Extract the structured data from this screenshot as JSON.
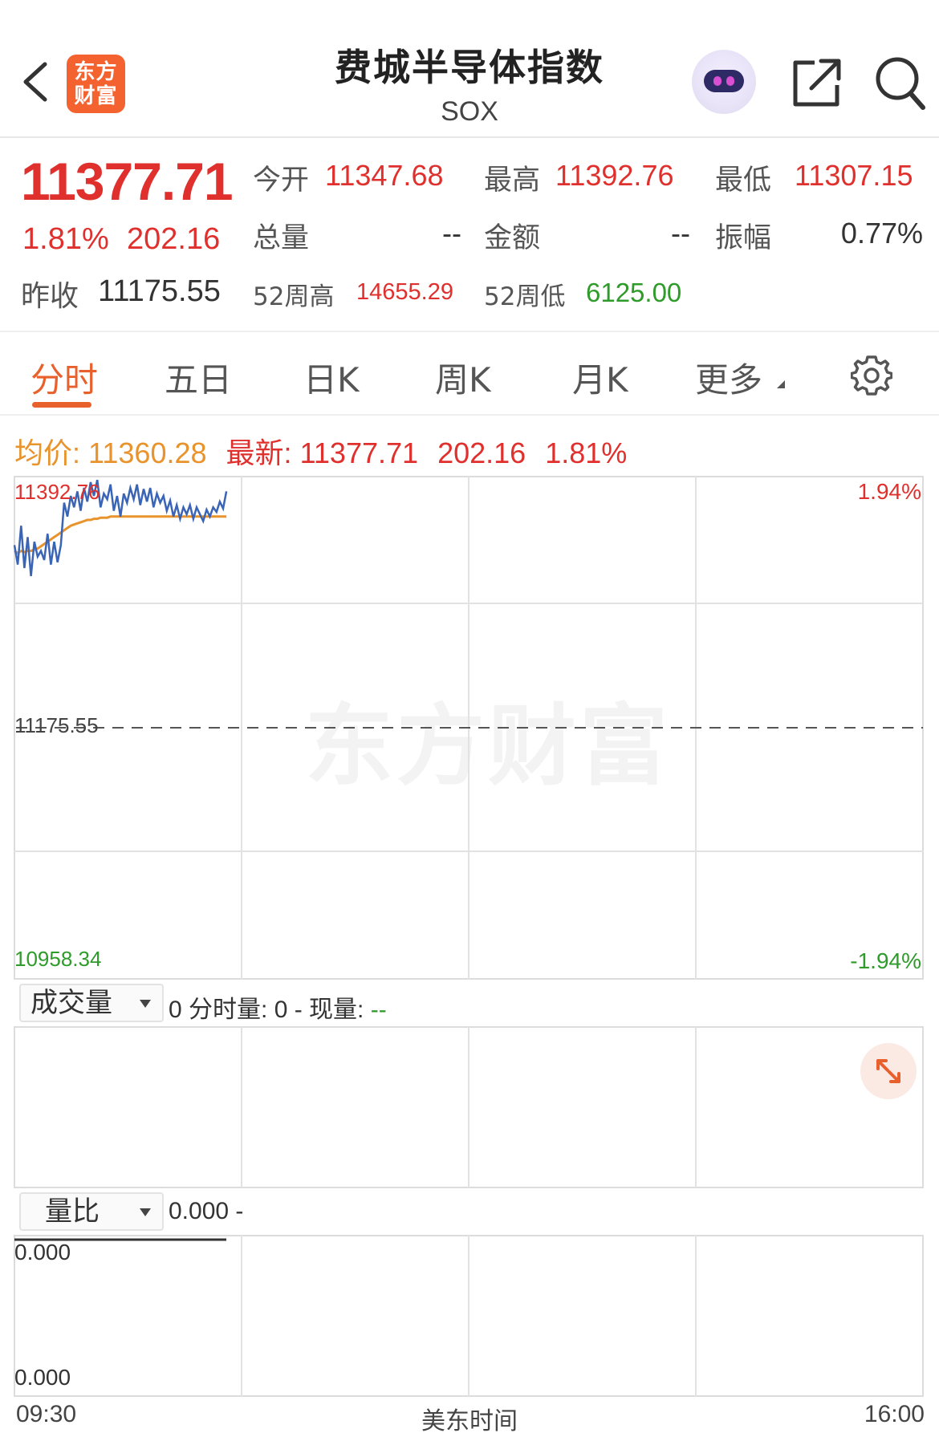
{
  "header": {
    "title": "费城半导体指数",
    "subtitle": "SOX",
    "logo_text_line1": "东方",
    "logo_text_line2": "财富"
  },
  "quote": {
    "price": "11377.71",
    "change_pct": "1.81%",
    "change_abs": "202.16",
    "prev_close_label": "昨收",
    "prev_close": "11175.55",
    "open_label": "今开",
    "open": "11347.68",
    "high_label": "最高",
    "high": "11392.76",
    "low_label": "最低",
    "low": "11307.15",
    "volume_label": "总量",
    "volume": "--",
    "amount_label": "金额",
    "amount": "--",
    "amplitude_label": "振幅",
    "amplitude": "0.77%",
    "w52_high_label": "52周高",
    "w52_high": "14655.29",
    "w52_low_label": "52周低",
    "w52_low": "6125.00"
  },
  "tabs": [
    {
      "label": "分时",
      "active": true
    },
    {
      "label": "五日"
    },
    {
      "label": "日K"
    },
    {
      "label": "周K"
    },
    {
      "label": "月K"
    },
    {
      "label": "更多"
    }
  ],
  "infobar": {
    "avg_label": "均价:",
    "avg": "11360.28",
    "latest_label": "最新:",
    "latest": "11377.71",
    "latest_chg": "202.16",
    "latest_pct": "1.81%"
  },
  "chart_data": [
    {
      "type": "line",
      "title": "",
      "x_axis_start": "09:30",
      "x_axis_end": "16:00",
      "x_axis_center_label": "美东时间",
      "y_max_label": "11392.76",
      "y_mid_label": "11175.55",
      "y_min_label": "10958.34",
      "pct_max_label": "1.94%",
      "pct_min_label": "-1.94%",
      "ylim": [
        10958.34,
        11392.76
      ],
      "prev_close": 11175.55,
      "series": [],
      "price_values": [
        11335,
        11318,
        11352,
        11315,
        11342,
        11308,
        11338,
        11325,
        11330,
        11322,
        11345,
        11318,
        11338,
        11320,
        11335,
        11372,
        11360,
        11378,
        11368,
        11382,
        11365,
        11385,
        11373,
        11390,
        11378,
        11392,
        11368,
        11380,
        11375,
        11388,
        11365,
        11378,
        11360,
        11380,
        11372,
        11385,
        11375,
        11388,
        11370,
        11384,
        11373,
        11385,
        11368,
        11380,
        11372,
        11378,
        11365,
        11374,
        11360,
        11370,
        11358,
        11368,
        11362,
        11370,
        11358,
        11368,
        11362,
        11356,
        11366,
        11360,
        11368,
        11364,
        11373,
        11367,
        11382
      ],
      "avg_values": [
        11330,
        11328,
        11330,
        11329,
        11330,
        11330,
        11331,
        11332,
        11334,
        11336,
        11338,
        11340,
        11342,
        11344,
        11346,
        11348,
        11350,
        11352,
        11353,
        11354,
        11355,
        11356,
        11357,
        11357,
        11358,
        11358,
        11359,
        11359,
        11359,
        11360,
        11360,
        11360,
        11360,
        11360,
        11360,
        11360,
        11360,
        11360,
        11360,
        11360,
        11360,
        11360,
        11360,
        11360,
        11360,
        11360,
        11360,
        11360,
        11360,
        11360,
        11360,
        11360,
        11360,
        11360,
        11360,
        11360,
        11360,
        11360,
        11360,
        11360,
        11360,
        11360,
        11360,
        11360,
        11360
      ]
    }
  ],
  "volume_panel": {
    "selector": "成交量",
    "info_prefix": "0 分时量: 0 - 现量: ",
    "info_suffix": "--"
  },
  "ratio_panel": {
    "selector": "量比",
    "info": "0.000 -",
    "y_top": "0.000",
    "y_bottom": "0.000"
  },
  "watermark": "东方财富",
  "colors": {
    "up": "#e0302d",
    "down": "#2e9b2a",
    "accent": "#e8612c",
    "avg_line": "#e8932c",
    "price_line": "#3a64b6"
  }
}
